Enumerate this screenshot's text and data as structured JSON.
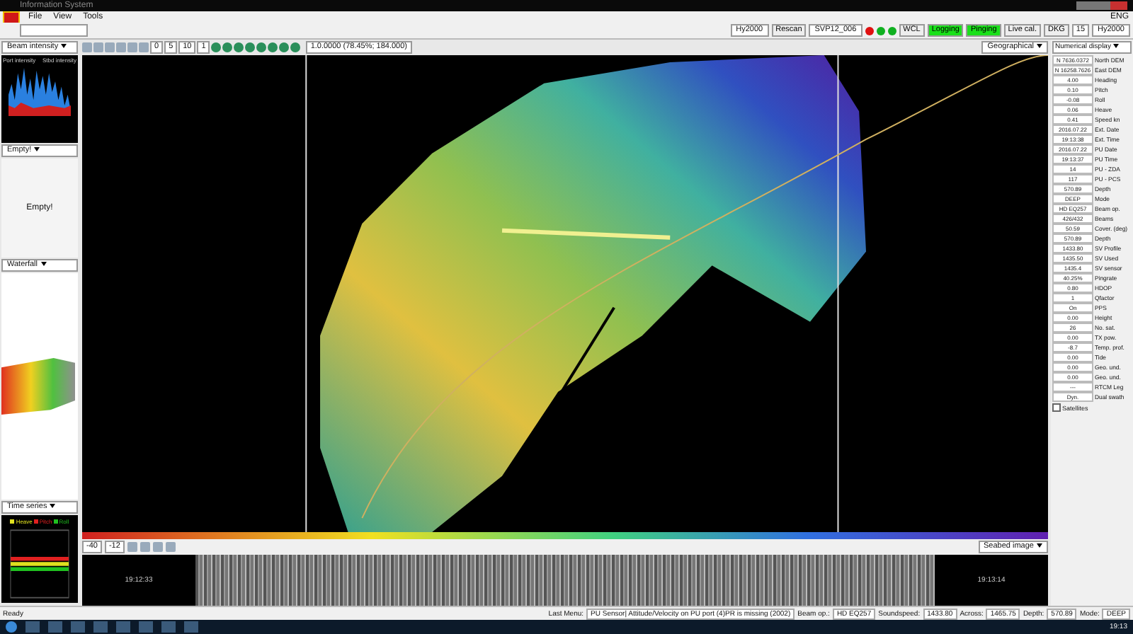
{
  "window": {
    "title": "Information System"
  },
  "menu": [
    "File",
    "View",
    "Tools"
  ],
  "language": "ENG",
  "top_toolbar": {
    "sensor_combo": "Hy2000",
    "rescan": "Rescan",
    "svp_combo": "SVP12_006",
    "lights": [
      {
        "color": "#e01010"
      },
      {
        "color": "#10b020"
      },
      {
        "color": "#10b020"
      }
    ],
    "toggles": [
      {
        "label": "WCL",
        "on": false
      },
      {
        "label": "Logging",
        "on": true
      },
      {
        "label": "Pinging",
        "on": true
      },
      {
        "label": "Live cal.",
        "on": false
      },
      {
        "label": "DKG",
        "on": false
      }
    ],
    "count": "15",
    "right_combo": "Hy2000"
  },
  "left_panel": {
    "intensity_combo": "Beam intensity",
    "port_label": "Port intensity",
    "stbd_label": "Stbd intensity",
    "empty_combo": "Empty!",
    "empty_text": "Empty!",
    "waterfall_combo": "Waterfall",
    "timeseries_combo": "Time series",
    "legend": [
      {
        "label": "Heave",
        "color": "#e0e020"
      },
      {
        "label": "Pitch",
        "color": "#e02020"
      },
      {
        "label": "Roll",
        "color": "#20c020"
      }
    ]
  },
  "map_toolbar": {
    "fields": [
      "0",
      "5",
      "10",
      "1"
    ],
    "coordinates": "1.0.0000 (78.45%; 184.000)",
    "view_combo": "Geographical"
  },
  "seabed": {
    "fields": [
      "-40",
      "-12"
    ],
    "view_combo": "Seabed image",
    "times": [
      "19:12:33",
      "19:13:14"
    ]
  },
  "numerical": {
    "combo": "Numerical display",
    "rows": [
      {
        "value": "N 7636.0372",
        "label": "North DEM"
      },
      {
        "value": "N 16258.7626",
        "label": "East DEM"
      },
      {
        "value": "4.00",
        "label": "Heading"
      },
      {
        "value": "0.10",
        "label": "Pitch"
      },
      {
        "value": "-0.08",
        "label": "Roll"
      },
      {
        "value": "0.06",
        "label": "Heave"
      },
      {
        "value": "0.41",
        "label": "Speed kn"
      },
      {
        "value": "2016.07.22",
        "label": "Ext. Date"
      },
      {
        "value": "19:13:38",
        "label": "Ext. Time"
      },
      {
        "value": "2016.07.22",
        "label": "PU Date"
      },
      {
        "value": "19:13:37",
        "label": "PU Time"
      },
      {
        "value": "14",
        "label": "PU - ZDA"
      },
      {
        "value": "117",
        "label": "PU - PCS"
      },
      {
        "value": "570.89",
        "label": "Depth"
      },
      {
        "value": "DEEP",
        "label": "Mode"
      },
      {
        "value": "HD EQ257",
        "label": "Beam op."
      },
      {
        "value": "426/432",
        "label": "Beams"
      },
      {
        "value": "50.59",
        "label": "Cover. (deg)"
      },
      {
        "value": "570.89",
        "label": "Depth"
      },
      {
        "value": "1433.80",
        "label": "SV Profile"
      },
      {
        "value": "1435.50",
        "label": "SV Used"
      },
      {
        "value": "1435.4",
        "label": "SV sensor"
      },
      {
        "value": "40.25%",
        "label": "Pingrate"
      },
      {
        "value": "0.80",
        "label": "HDOP"
      },
      {
        "value": "1",
        "label": "Qfactor"
      },
      {
        "value": "On",
        "label": "PPS"
      },
      {
        "value": "0.00",
        "label": "Height"
      },
      {
        "value": "26",
        "label": "No. sat."
      },
      {
        "value": "0.00",
        "label": "TX pow."
      },
      {
        "value": "-8.7",
        "label": "Temp. prof."
      },
      {
        "value": "0.00",
        "label": "Tide"
      },
      {
        "value": "0.00",
        "label": "Geo. und."
      },
      {
        "value": "0.00",
        "label": "Geo. und."
      },
      {
        "value": "---",
        "label": "RTCM Leg"
      },
      {
        "value": "Dyn.",
        "label": "Dual swath"
      }
    ],
    "satellites": {
      "label": "Satellites",
      "checked": false
    }
  },
  "status_bar": {
    "ready": "Ready",
    "last_menu_label": "Last Menu:",
    "message": "PU Sensor| Attitude/Velocity on PU port (4)PR is missing (2002)",
    "fields": [
      {
        "label": "Beam op.:",
        "value": "HD EQ257"
      },
      {
        "label": "Soundspeed:",
        "value": "1433.80"
      },
      {
        "label": "Across:",
        "value": "1465.75"
      },
      {
        "label": "Depth:",
        "value": "570.89"
      },
      {
        "label": "Mode:",
        "value": "DEEP"
      }
    ]
  },
  "taskbar": {
    "clock": "19:13"
  }
}
